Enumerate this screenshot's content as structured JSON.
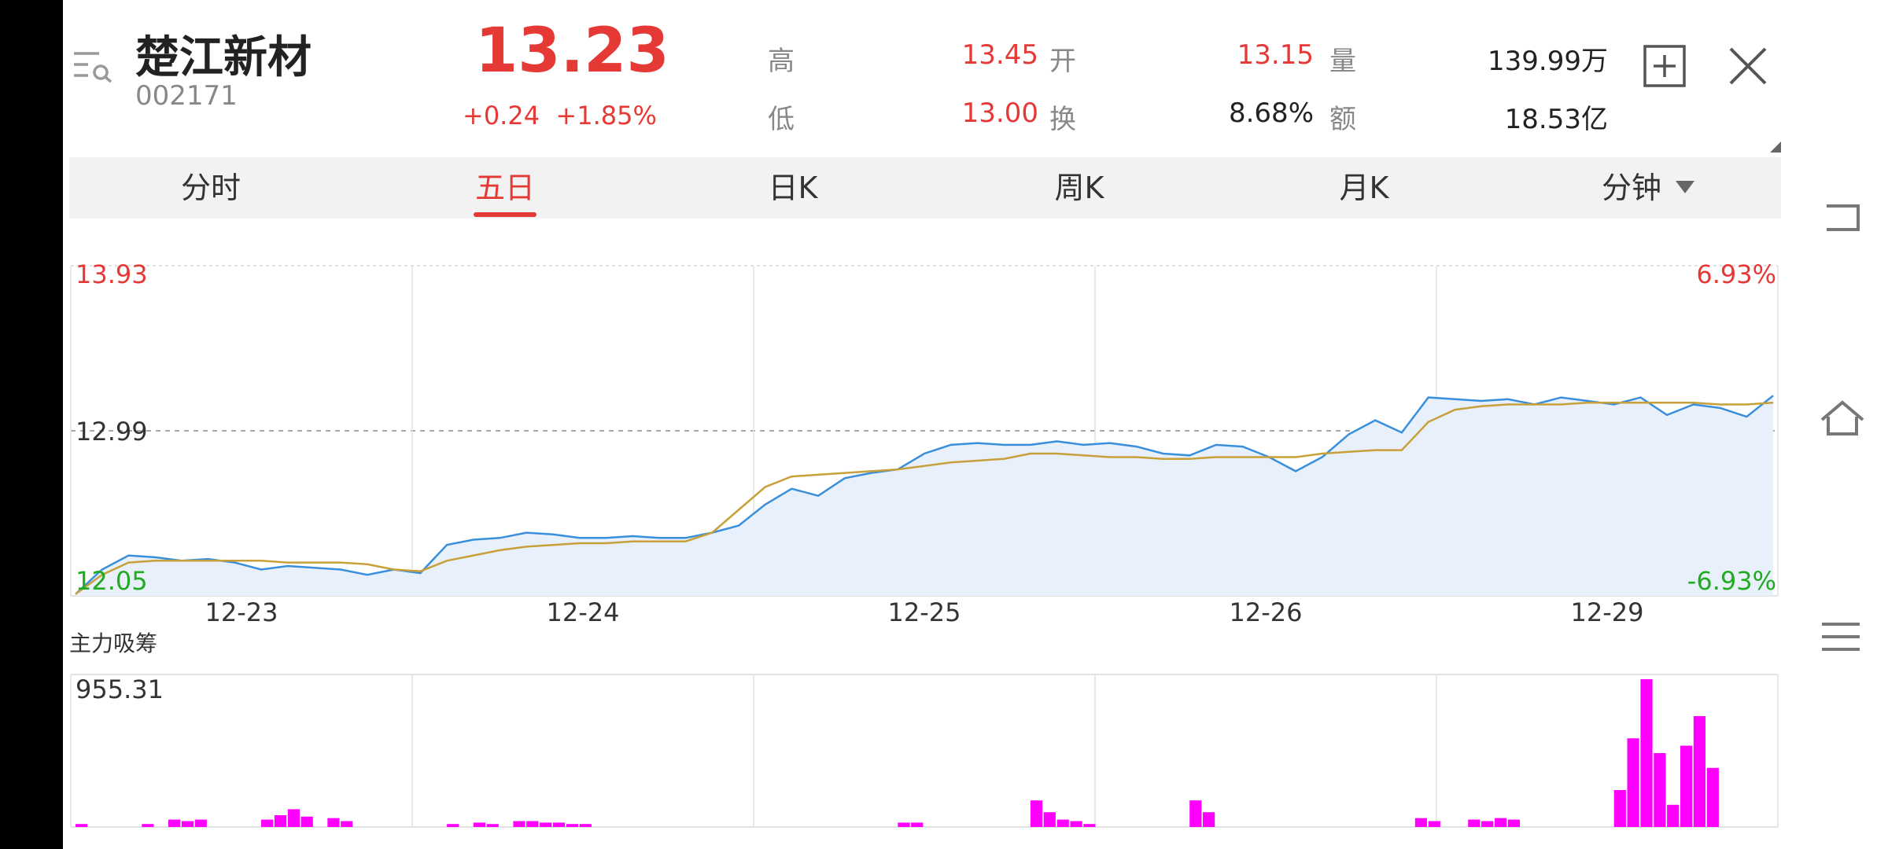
{
  "header": {
    "menu_icon": "menu-search-icon",
    "name": "楚江新材",
    "code": "002171",
    "price": "13.23",
    "change": "+0.24  +1.85%",
    "stats": {
      "high_label": "高",
      "high_value": "13.45",
      "open_label": "开",
      "open_value": "13.15",
      "volume_label": "量",
      "volume_value": "139.99万",
      "low_label": "低",
      "low_value": "13.00",
      "turnover_label": "换",
      "turnover_value": "8.68%",
      "amount_label": "额",
      "amount_value": "18.53亿"
    },
    "add_icon": "plus-square-icon",
    "close_icon": "close-icon"
  },
  "tabs": [
    {
      "label": "分时",
      "active": false
    },
    {
      "label": "五日",
      "active": true
    },
    {
      "label": "日K",
      "active": false
    },
    {
      "label": "周K",
      "active": false
    },
    {
      "label": "月K",
      "active": false
    },
    {
      "label": "分钟",
      "active": false
    }
  ],
  "right_nav": [
    "back-icon",
    "home-icon",
    "menu-icon"
  ],
  "chart_data": [
    {
      "type": "line",
      "y_top_label": "13.93",
      "y_mid_label": "12.99",
      "y_bottom_label": "12.05",
      "pct_top_label": "6.93%",
      "pct_bottom_label": "-6.93%",
      "ylim": [
        12.05,
        13.93
      ],
      "categories": [
        "12-23",
        "12-24",
        "12-25",
        "12-26",
        "12-29"
      ],
      "series": [
        {
          "values": [
            12.06,
            12.2,
            12.28,
            12.27,
            12.25,
            12.26,
            12.24,
            12.2,
            12.22,
            12.21,
            12.2,
            12.17,
            12.2,
            12.18,
            12.34,
            12.37,
            12.38,
            12.41,
            12.4,
            12.38,
            12.38,
            12.39,
            12.38,
            12.38,
            12.41,
            12.45,
            12.57,
            12.66,
            12.62,
            12.72,
            12.75,
            12.77,
            12.86,
            12.91,
            12.92,
            12.91,
            12.91,
            12.93,
            12.91,
            12.92,
            12.9,
            12.86,
            12.85,
            12.91,
            12.9,
            12.84,
            12.76,
            12.84,
            12.97,
            13.05,
            12.98,
            13.18,
            13.17,
            13.16,
            13.17,
            13.14,
            13.18,
            13.16,
            13.14,
            13.18,
            13.08,
            13.14,
            13.12,
            13.07,
            13.19
          ]
        },
        {
          "values": [
            12.06,
            12.17,
            12.24,
            12.25,
            12.25,
            12.25,
            12.25,
            12.25,
            12.24,
            12.24,
            12.24,
            12.23,
            12.2,
            12.19,
            12.25,
            12.28,
            12.31,
            12.33,
            12.34,
            12.35,
            12.35,
            12.36,
            12.36,
            12.36,
            12.41,
            12.54,
            12.67,
            12.73,
            12.74,
            12.75,
            12.76,
            12.77,
            12.79,
            12.81,
            12.82,
            12.83,
            12.86,
            12.86,
            12.85,
            12.84,
            12.84,
            12.83,
            12.83,
            12.84,
            12.84,
            12.84,
            12.84,
            12.86,
            12.87,
            12.88,
            12.88,
            13.04,
            13.11,
            13.13,
            13.14,
            13.14,
            13.14,
            13.15,
            13.15,
            13.15,
            13.15,
            13.15,
            13.14,
            13.14,
            13.15
          ]
        }
      ],
      "colors": {
        "price": "#3a8fdc",
        "avg": "#c8a03a",
        "fill": "#e8f1fb",
        "up": "#e53935",
        "down": "#22aa22"
      }
    },
    {
      "type": "area",
      "title": "主力吸筹",
      "max_label": "955.31",
      "ylim": [
        0,
        955.31
      ],
      "values": [
        0.02,
        0.0,
        0.0,
        0.0,
        0.0,
        0.02,
        0.0,
        0.05,
        0.04,
        0.05,
        0.0,
        0.0,
        0.0,
        0.0,
        0.05,
        0.08,
        0.12,
        0.07,
        0.0,
        0.06,
        0.04,
        0.0,
        0.0,
        0.0,
        0.0,
        0.0,
        0.0,
        0.0,
        0.02,
        0.0,
        0.03,
        0.02,
        0.0,
        0.04,
        0.04,
        0.03,
        0.03,
        0.02,
        0.02,
        0.0,
        0.0,
        0.0,
        0.0,
        0.0,
        0.0,
        0.0,
        0.0,
        0.0,
        0.0,
        0.0,
        0.0,
        0.0,
        0.0,
        0.0,
        0.0,
        0.0,
        0.0,
        0.0,
        0.0,
        0.0,
        0.0,
        0.0,
        0.03,
        0.03,
        0.0,
        0.0,
        0.0,
        0.0,
        0.0,
        0.0,
        0.0,
        0.0,
        0.18,
        0.1,
        0.05,
        0.04,
        0.02,
        0.0,
        0.0,
        0.0,
        0.0,
        0.0,
        0.0,
        0.0,
        0.18,
        0.1,
        0.0,
        0.0,
        0.0,
        0.0,
        0.0,
        0.0,
        0.0,
        0.0,
        0.0,
        0.0,
        0.0,
        0.0,
        0.0,
        0.0,
        0.0,
        0.06,
        0.04,
        0.0,
        0.0,
        0.05,
        0.04,
        0.06,
        0.05,
        0.0,
        0.0,
        0.0,
        0.0,
        0.0,
        0.0,
        0.0,
        0.25,
        0.6,
        1.0,
        0.5,
        0.15,
        0.55,
        0.75,
        0.4,
        0.0,
        0.0,
        0.0,
        0.0
      ],
      "color": "#ff00ff"
    }
  ]
}
